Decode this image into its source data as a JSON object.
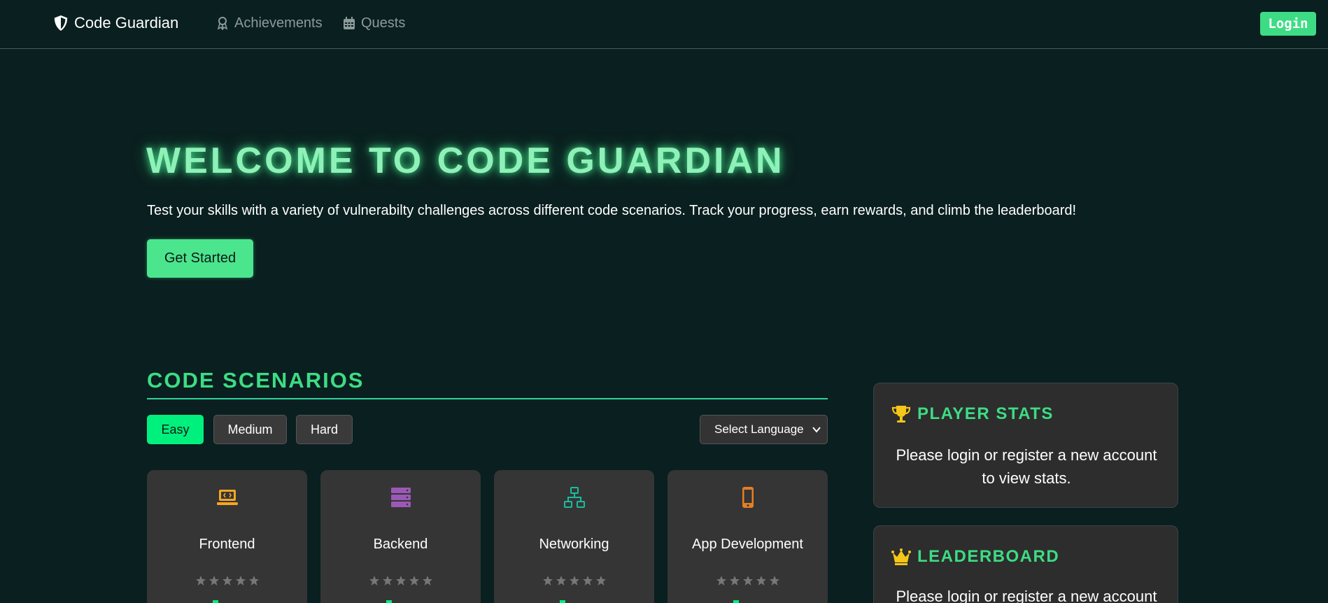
{
  "nav": {
    "brand": "Code Guardian",
    "links": [
      {
        "label": "Achievements",
        "icon": "award-icon"
      },
      {
        "label": "Quests",
        "icon": "calendar-icon"
      }
    ],
    "login_label": "Login"
  },
  "hero": {
    "title": "WELCOME TO CODE GUARDIAN",
    "subtitle": "Test your skills with a variety of vulnerabilty challenges across different code scenarios. Track your progress, earn rewards, and climb the leaderboard!",
    "cta_label": "Get Started"
  },
  "scenarios": {
    "title": "CODE SCENARIOS",
    "difficulties": [
      {
        "label": "Easy",
        "active": true
      },
      {
        "label": "Medium",
        "active": false
      },
      {
        "label": "Hard",
        "active": false
      }
    ],
    "language_select": "Select Language",
    "cards": [
      {
        "title": "Frontend",
        "icon": "laptop-code-icon",
        "icon_color": "#f5a623",
        "rating": 0
      },
      {
        "title": "Backend",
        "icon": "server-icon",
        "icon_color": "#9b59b6",
        "rating": 0
      },
      {
        "title": "Networking",
        "icon": "network-icon",
        "icon_color": "#1abc9c",
        "rating": 0
      },
      {
        "title": "App Development",
        "icon": "mobile-icon",
        "icon_color": "#e67e22",
        "rating": 0
      }
    ]
  },
  "player_stats": {
    "title": "PLAYER STATS",
    "message": "Please login or register a new account to view stats."
  },
  "leaderboard": {
    "title": "LEADERBOARD",
    "message": "Please login or register a new account to"
  },
  "colors": {
    "background": "#0a1f1f",
    "accent": "#3ddc84",
    "active_button": "#00f07e",
    "card": "#353535",
    "trophy": "#f5c518"
  }
}
